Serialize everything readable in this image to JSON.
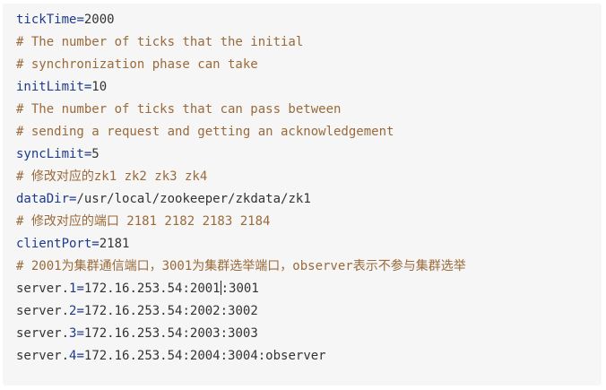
{
  "code": {
    "tickTime_key": "tickTime",
    "tickTime_val": "2000",
    "c1": "# The number of ticks that the initial",
    "c2": "# synchronization phase can take",
    "initLimit_key": "initLimit",
    "initLimit_val": "10",
    "c3": "# The number of ticks that can pass between",
    "c4": "# sending a request and getting an acknowledgement",
    "syncLimit_key": "syncLimit",
    "syncLimit_val": "5",
    "c5": "# 修改对应的zk1 zk2 zk3 zk4",
    "dataDir_key": "dataDir",
    "dataDir_val": "/usr/local/zookeeper/zkdata/zk1",
    "c6": "# 修改对应的端口 2181 2182 2183 2184",
    "clientPort_key": "clientPort",
    "clientPort_val": "2181",
    "c7": "# 2001为集群通信端口，3001为集群选举端口，observer表示不参与集群选举",
    "server_prefix": "server.",
    "servers": [
      {
        "id": "1",
        "val_a": "172.16.253.54:2001",
        "val_b": ":3001"
      },
      {
        "id": "2",
        "val": "172.16.253.54:2002:3002"
      },
      {
        "id": "3",
        "val": "172.16.253.54:2003:3003"
      },
      {
        "id": "4",
        "val": "172.16.253.54:2004:3004:observer"
      }
    ]
  }
}
